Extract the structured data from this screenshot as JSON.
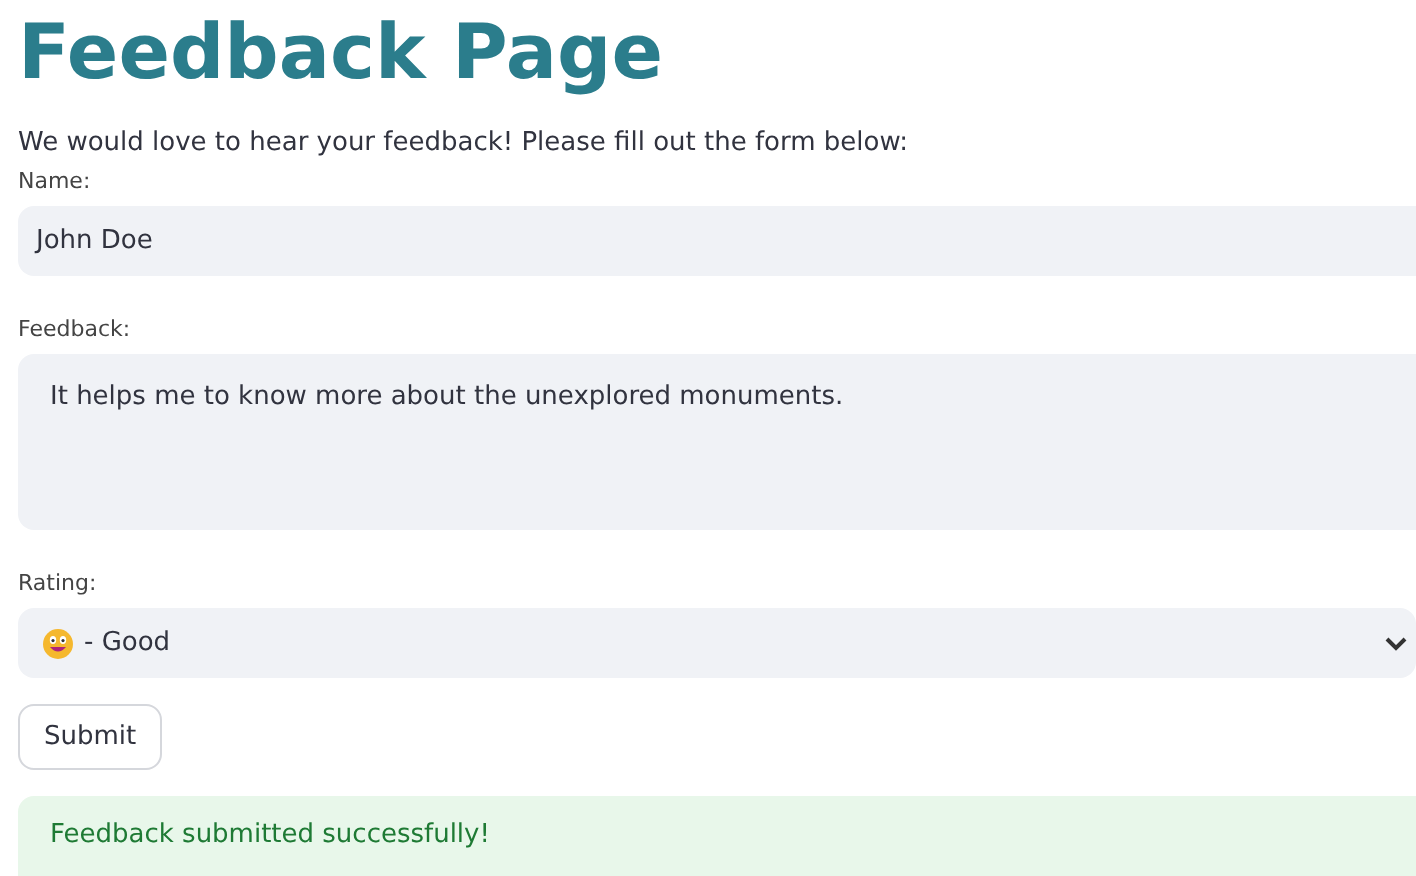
{
  "title": "Feedback Page",
  "intro": "We would love to hear your feedback! Please fill out the form below:",
  "name_field": {
    "label": "Name:",
    "value": "John Doe"
  },
  "feedback_field": {
    "label": "Feedback:",
    "value": "It helps me to know more about the unexplored monuments."
  },
  "rating_field": {
    "label": "Rating:",
    "value": "- Good"
  },
  "submit_button": "Submit",
  "success_message": "Feedback submitted successfully!"
}
